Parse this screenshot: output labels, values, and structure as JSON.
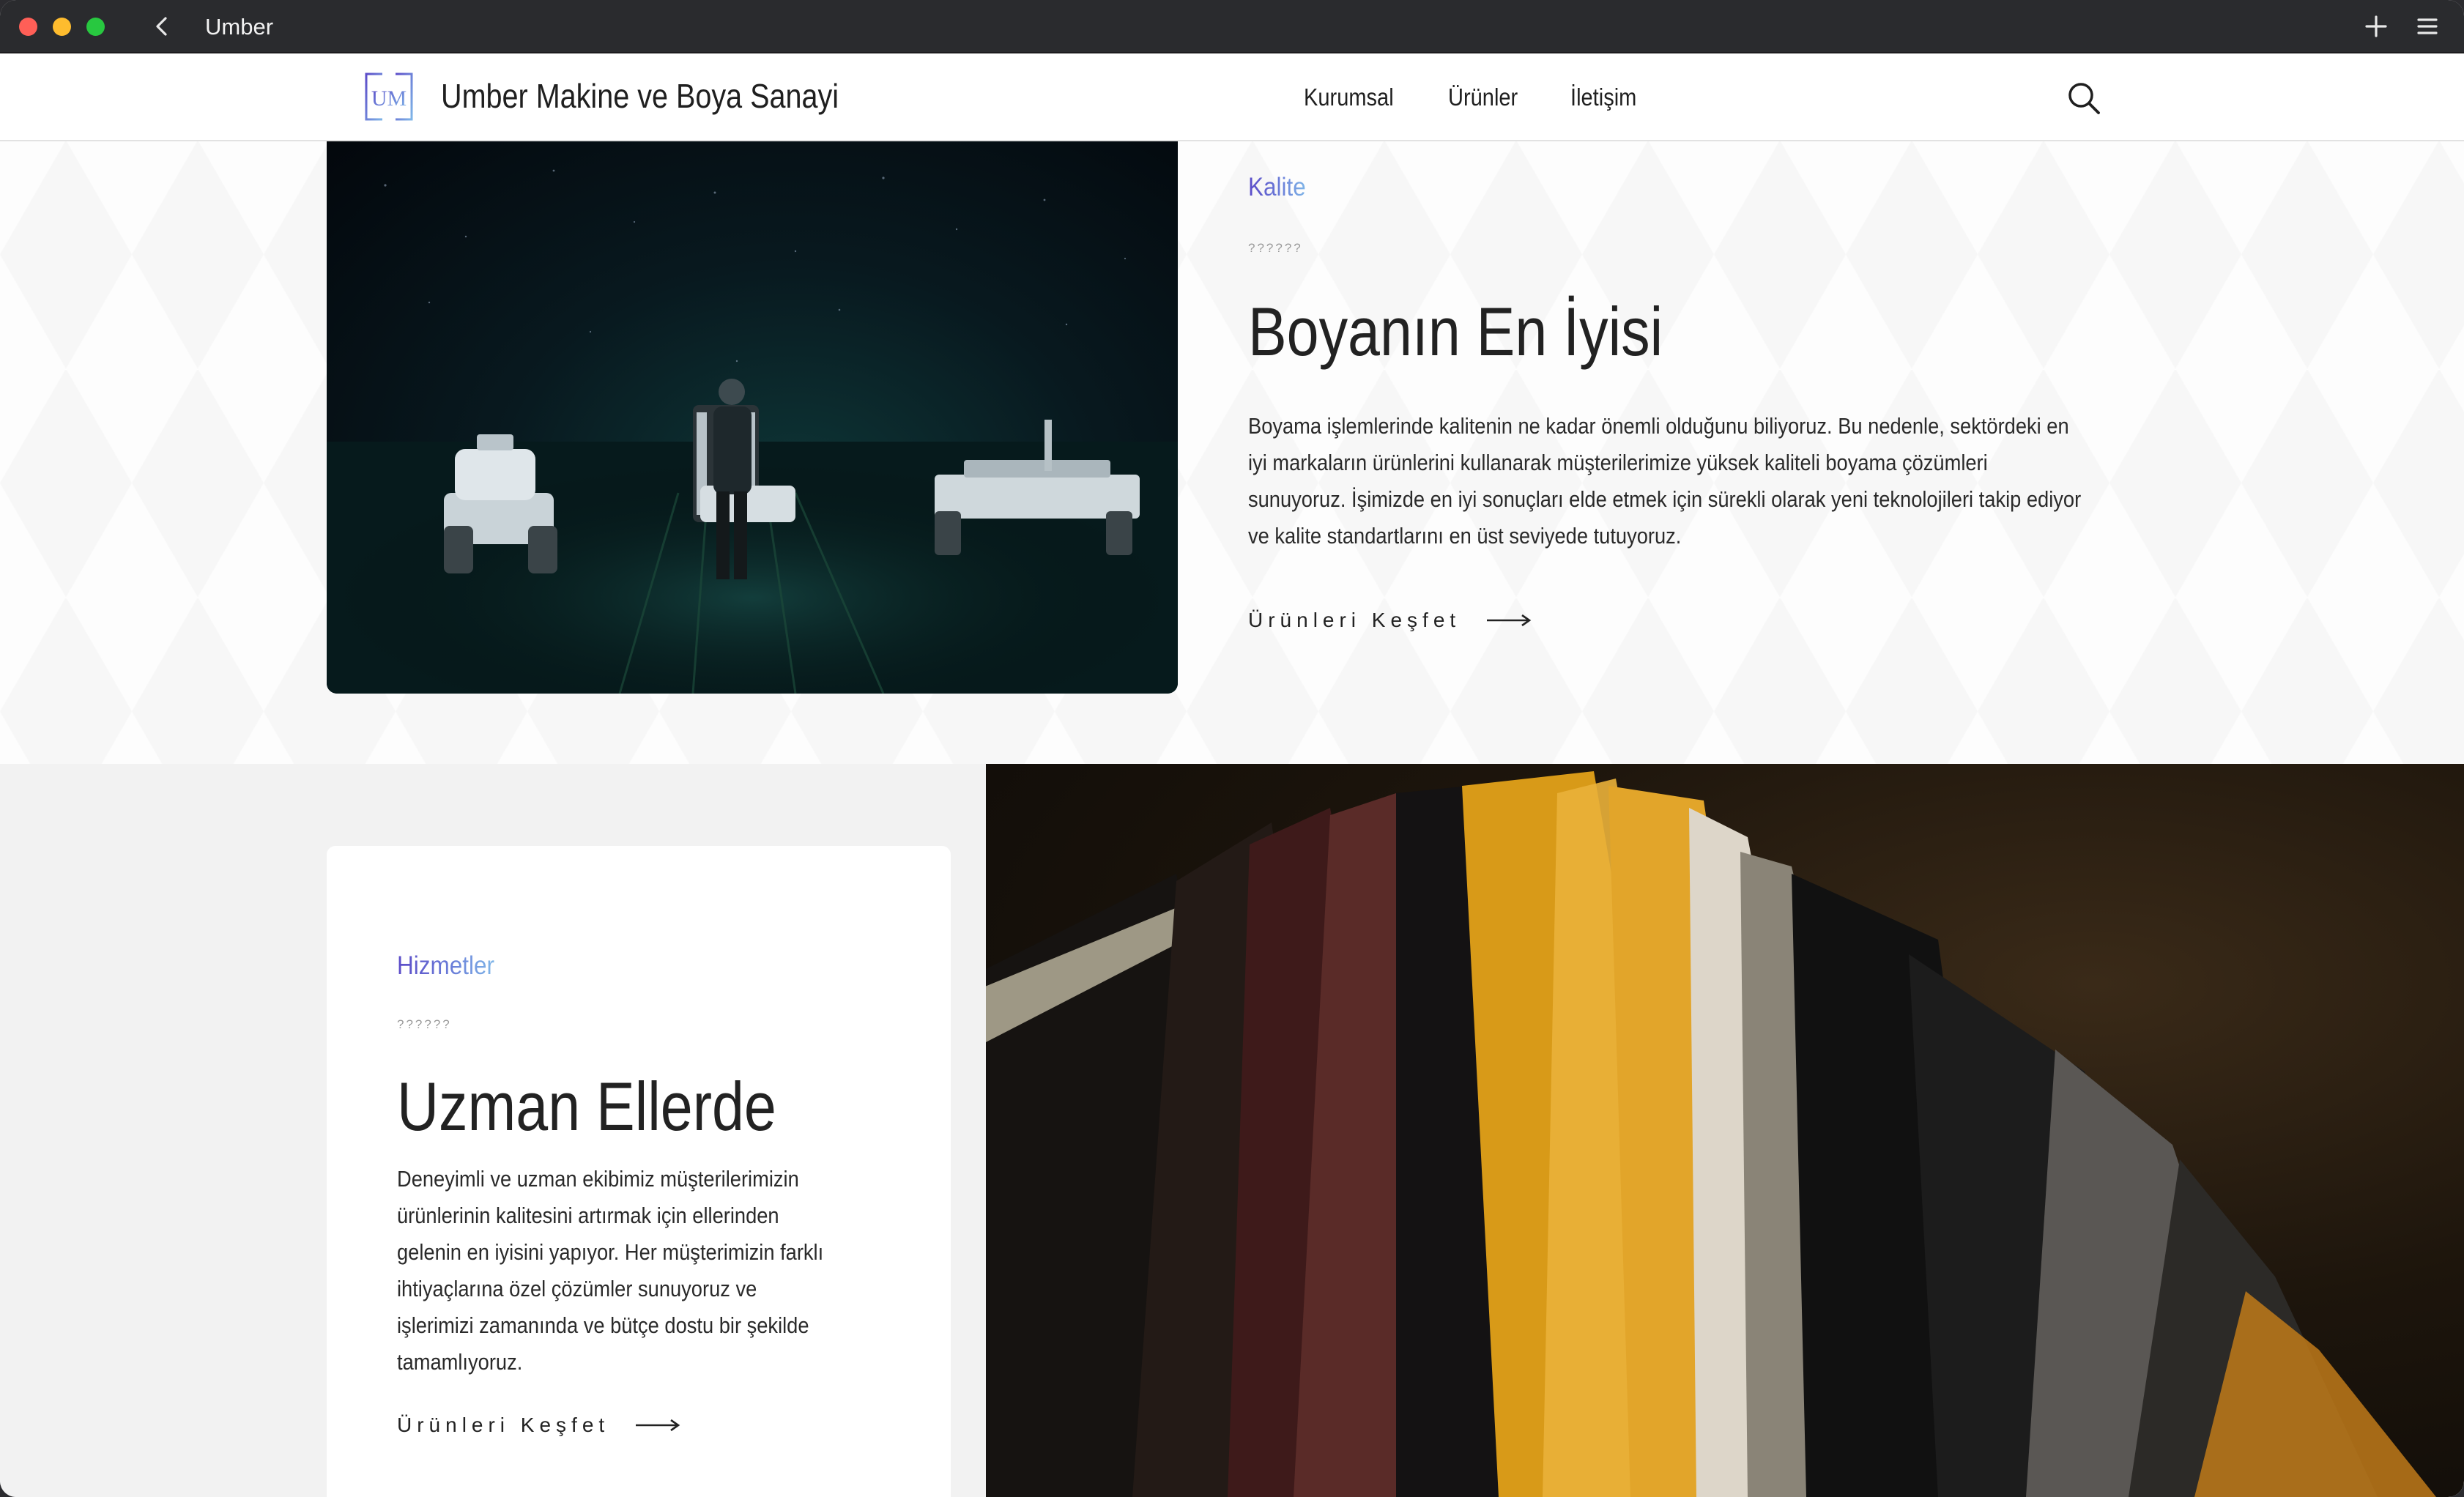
{
  "window": {
    "title": "Umber"
  },
  "header": {
    "logo_text": "UM",
    "brand": "Umber Makine ve Boya Sanayi",
    "nav": [
      {
        "label": "Kurumsal"
      },
      {
        "label": "Ürünler"
      },
      {
        "label": "İletişim"
      }
    ]
  },
  "section_quality": {
    "eyebrow": "Kalite",
    "dots": "??????",
    "heading": "Boyanın En İyisi",
    "paragraph": "Boyama işlemlerinde kalitenin ne kadar önemli olduğunu biliyoruz. Bu nedenle, sektördeki en iyi markaların ürünlerini kullanarak müşterilerimize yüksek kaliteli boyama çözümleri sunuyoruz. İşimizde en iyi sonuçları elde etmek için sürekli olarak yeni teknolojileri takip ediyor ve kalite standartlarını en üst seviyede tutuyoruz.",
    "cta": "Ürünleri Keşfet"
  },
  "section_services": {
    "eyebrow": "Hizmetler",
    "dots": "??????",
    "heading": "Uzman Ellerde",
    "paragraph": "Deneyimli ve uzman ekibimiz müşterilerimizin ürünlerinin kalitesini artırmak için ellerinden gelenin en iyisini yapıyor. Her müşterimizin farklı ihtiyaçlarına özel çözümler sunuyoruz ve işlerimizi zamanında ve bütçe dostu bir şekilde tamamlıyoruz.",
    "cta": "Ürünleri Keşfet"
  },
  "colors": {
    "titlebar": "#2a2b2e",
    "accent_start": "#5b4bc8",
    "accent_end": "#7fb6e8",
    "text": "#222222"
  },
  "icons": {
    "back": "chevron-left-icon",
    "new_tab": "plus-icon",
    "menu": "hamburger-menu-icon",
    "search": "search-icon",
    "cta_arrow": "arrow-right-icon"
  }
}
